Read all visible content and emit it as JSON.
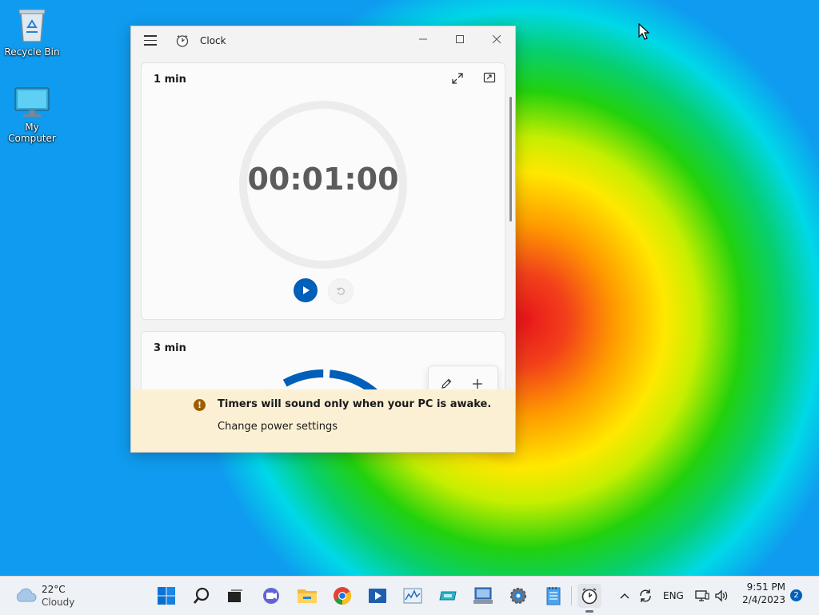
{
  "desktop": {
    "icons": [
      {
        "label": "Recycle Bin",
        "icon": "recycle-bin-icon"
      },
      {
        "label": "My Computer",
        "icon": "computer-icon"
      }
    ]
  },
  "window": {
    "title": "Clock",
    "timers": [
      {
        "name": "1 min",
        "time": "00:01:00"
      },
      {
        "name": "3 min"
      }
    ],
    "banner": {
      "message": "Timers will sound only when your PC is awake.",
      "link": "Change power settings"
    }
  },
  "taskbar": {
    "weather": {
      "temp": "22°C",
      "condition": "Cloudy"
    },
    "apps": [
      "start",
      "search",
      "task-view",
      "teams-chat",
      "file-explorer",
      "chrome",
      "media-player",
      "task-manager",
      "network-tool",
      "control-panel",
      "settings",
      "notepad",
      "clock"
    ],
    "tray": {
      "language": "ENG",
      "time": "9:51 PM",
      "date": "2/4/2023",
      "notifications": "2"
    }
  },
  "colors": {
    "accent": "#005fb8",
    "banner_bg": "#fcf0d4",
    "warning": "#9d5d00"
  }
}
